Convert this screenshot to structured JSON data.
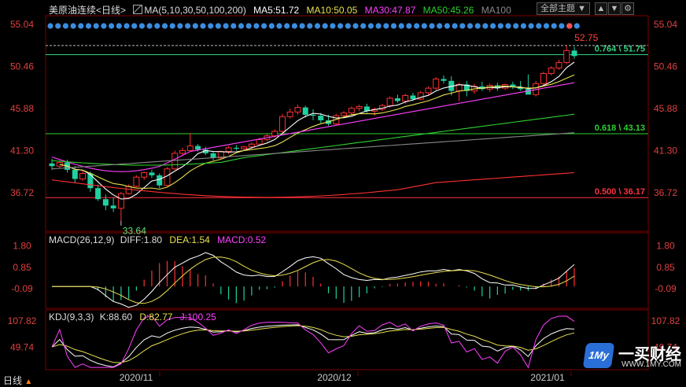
{
  "header": {
    "symbol": "美原油连续",
    "period": "<日线>",
    "ma_label": "MA(5,10,30,50,100,200)",
    "ma5": "MA5:51.72",
    "ma10": "MA10:50.05",
    "ma30": "MA30:47.87",
    "ma50": "MA50:45.26",
    "ma100": "MA100",
    "theme_button": "全部主题",
    "colors": {
      "ma5": "#ffffff",
      "ma10": "#e8e050",
      "ma30": "#ff40ff",
      "ma50": "#30d030",
      "ma100": "#888888"
    }
  },
  "macd_header": {
    "label": "MACD(26,12,9)",
    "diff": "DIFF:1.80",
    "dea": "DEA:1.54",
    "macd": "MACD:0.52"
  },
  "kdj_header": {
    "label": "KDJ(9,3,3)",
    "k": "K:88.60",
    "d": "D:82.77",
    "j": "J:100.25"
  },
  "footer": {
    "period_tab": "日线",
    "x_labels": [
      "2020/11",
      "2020/12",
      "2021/01"
    ]
  },
  "watermark": {
    "brand": "一买财经",
    "url": "WWW.1MY.COM",
    "logo_text": "1My"
  },
  "chart_data": {
    "type": "candlestick",
    "y_ticks": [
      "55.04",
      "50.46",
      "45.88",
      "41.30",
      "36.72"
    ],
    "ylim": [
      32.5,
      56.0
    ],
    "annotations": {
      "high_label": "52.75",
      "low_label": "33.64",
      "fib_levels": [
        {
          "label": "0.764 \\ 51.75",
          "value": 51.75,
          "color": "#30d080"
        },
        {
          "label": "0.618 \\ 43.13",
          "value": 43.13,
          "color": "#30d030"
        },
        {
          "label": "0.500 \\ 36.17",
          "value": 36.17,
          "color": "#ff3040"
        }
      ]
    },
    "candles": [
      {
        "o": 39.9,
        "h": 40.4,
        "l": 39.2,
        "c": 39.6
      },
      {
        "o": 39.6,
        "h": 40.2,
        "l": 39.4,
        "c": 40.0
      },
      {
        "o": 40.0,
        "h": 40.3,
        "l": 38.9,
        "c": 39.2
      },
      {
        "o": 39.2,
        "h": 39.6,
        "l": 37.8,
        "c": 38.2
      },
      {
        "o": 38.2,
        "h": 39.1,
        "l": 38.0,
        "c": 38.8
      },
      {
        "o": 38.8,
        "h": 39.0,
        "l": 36.8,
        "c": 37.2
      },
      {
        "o": 37.2,
        "h": 37.6,
        "l": 35.8,
        "c": 36.0
      },
      {
        "o": 36.0,
        "h": 36.5,
        "l": 34.8,
        "c": 35.3
      },
      {
        "o": 35.3,
        "h": 36.2,
        "l": 34.6,
        "c": 35.0
      },
      {
        "o": 35.0,
        "h": 36.8,
        "l": 33.64,
        "c": 36.6
      },
      {
        "o": 36.6,
        "h": 37.6,
        "l": 36.5,
        "c": 37.4
      },
      {
        "o": 37.4,
        "h": 38.6,
        "l": 37.3,
        "c": 38.4
      },
      {
        "o": 38.4,
        "h": 39.0,
        "l": 38.1,
        "c": 38.9
      },
      {
        "o": 38.9,
        "h": 39.2,
        "l": 38.3,
        "c": 38.6
      },
      {
        "o": 38.6,
        "h": 38.8,
        "l": 37.2,
        "c": 37.5
      },
      {
        "o": 37.5,
        "h": 39.5,
        "l": 37.4,
        "c": 39.3
      },
      {
        "o": 39.3,
        "h": 41.3,
        "l": 39.2,
        "c": 41.0
      },
      {
        "o": 41.0,
        "h": 41.6,
        "l": 40.8,
        "c": 41.3
      },
      {
        "o": 41.3,
        "h": 43.2,
        "l": 41.2,
        "c": 41.8
      },
      {
        "o": 41.8,
        "h": 42.0,
        "l": 41.2,
        "c": 41.4
      },
      {
        "o": 41.4,
        "h": 41.7,
        "l": 40.8,
        "c": 41.0
      },
      {
        "o": 41.0,
        "h": 41.2,
        "l": 40.2,
        "c": 40.5
      },
      {
        "o": 40.5,
        "h": 41.3,
        "l": 40.4,
        "c": 41.2
      },
      {
        "o": 41.2,
        "h": 41.8,
        "l": 40.9,
        "c": 41.6
      },
      {
        "o": 41.6,
        "h": 41.9,
        "l": 41.3,
        "c": 41.5
      },
      {
        "o": 41.5,
        "h": 41.8,
        "l": 41.3,
        "c": 41.7
      },
      {
        "o": 41.7,
        "h": 42.2,
        "l": 41.5,
        "c": 42.0
      },
      {
        "o": 42.0,
        "h": 42.7,
        "l": 41.9,
        "c": 42.5
      },
      {
        "o": 42.5,
        "h": 43.1,
        "l": 42.3,
        "c": 42.9
      },
      {
        "o": 42.9,
        "h": 43.6,
        "l": 42.7,
        "c": 43.4
      },
      {
        "o": 43.4,
        "h": 45.3,
        "l": 43.2,
        "c": 45.0
      },
      {
        "o": 45.0,
        "h": 45.9,
        "l": 44.8,
        "c": 45.5
      },
      {
        "o": 45.5,
        "h": 46.3,
        "l": 45.2,
        "c": 46.0
      },
      {
        "o": 46.0,
        "h": 46.2,
        "l": 44.9,
        "c": 45.2
      },
      {
        "o": 45.2,
        "h": 45.8,
        "l": 44.6,
        "c": 45.1
      },
      {
        "o": 45.1,
        "h": 45.4,
        "l": 44.3,
        "c": 44.6
      },
      {
        "o": 44.6,
        "h": 45.2,
        "l": 44.0,
        "c": 44.2
      },
      {
        "o": 44.2,
        "h": 45.3,
        "l": 44.1,
        "c": 45.1
      },
      {
        "o": 45.1,
        "h": 45.6,
        "l": 44.9,
        "c": 45.4
      },
      {
        "o": 45.4,
        "h": 46.1,
        "l": 45.2,
        "c": 45.9
      },
      {
        "o": 45.9,
        "h": 46.3,
        "l": 45.6,
        "c": 46.1
      },
      {
        "o": 46.1,
        "h": 46.4,
        "l": 45.4,
        "c": 45.6
      },
      {
        "o": 45.6,
        "h": 46.0,
        "l": 45.1,
        "c": 45.8
      },
      {
        "o": 45.8,
        "h": 46.4,
        "l": 45.6,
        "c": 46.2
      },
      {
        "o": 46.2,
        "h": 47.2,
        "l": 46.0,
        "c": 47.0
      },
      {
        "o": 47.0,
        "h": 47.4,
        "l": 46.5,
        "c": 46.7
      },
      {
        "o": 46.7,
        "h": 47.5,
        "l": 46.4,
        "c": 47.3
      },
      {
        "o": 47.3,
        "h": 47.6,
        "l": 46.7,
        "c": 46.9
      },
      {
        "o": 46.9,
        "h": 47.8,
        "l": 46.8,
        "c": 47.6
      },
      {
        "o": 47.6,
        "h": 48.3,
        "l": 47.4,
        "c": 48.1
      },
      {
        "o": 48.1,
        "h": 49.3,
        "l": 47.9,
        "c": 49.1
      },
      {
        "o": 49.1,
        "h": 49.5,
        "l": 48.6,
        "c": 48.9
      },
      {
        "o": 48.9,
        "h": 49.4,
        "l": 47.3,
        "c": 47.8
      },
      {
        "o": 47.8,
        "h": 48.7,
        "l": 46.7,
        "c": 48.5
      },
      {
        "o": 48.5,
        "h": 48.9,
        "l": 47.2,
        "c": 47.8
      },
      {
        "o": 47.8,
        "h": 48.6,
        "l": 47.5,
        "c": 48.3
      },
      {
        "o": 48.3,
        "h": 48.8,
        "l": 47.8,
        "c": 48.0
      },
      {
        "o": 48.0,
        "h": 48.6,
        "l": 47.7,
        "c": 48.4
      },
      {
        "o": 48.4,
        "h": 48.7,
        "l": 47.8,
        "c": 48.1
      },
      {
        "o": 48.1,
        "h": 48.6,
        "l": 47.9,
        "c": 48.5
      },
      {
        "o": 48.5,
        "h": 48.8,
        "l": 48.0,
        "c": 48.2
      },
      {
        "o": 48.2,
        "h": 48.9,
        "l": 47.8,
        "c": 48.0
      },
      {
        "o": 48.0,
        "h": 49.6,
        "l": 47.9,
        "c": 47.4
      },
      {
        "o": 47.4,
        "h": 48.9,
        "l": 47.2,
        "c": 48.6
      },
      {
        "o": 48.6,
        "h": 49.9,
        "l": 48.4,
        "c": 49.7
      },
      {
        "o": 49.7,
        "h": 50.5,
        "l": 49.5,
        "c": 50.3
      },
      {
        "o": 50.3,
        "h": 51.2,
        "l": 50.1,
        "c": 50.9
      },
      {
        "o": 50.9,
        "h": 52.75,
        "l": 50.7,
        "c": 52.2
      },
      {
        "o": 52.2,
        "h": 52.6,
        "l": 51.3,
        "c": 51.6
      }
    ]
  }
}
